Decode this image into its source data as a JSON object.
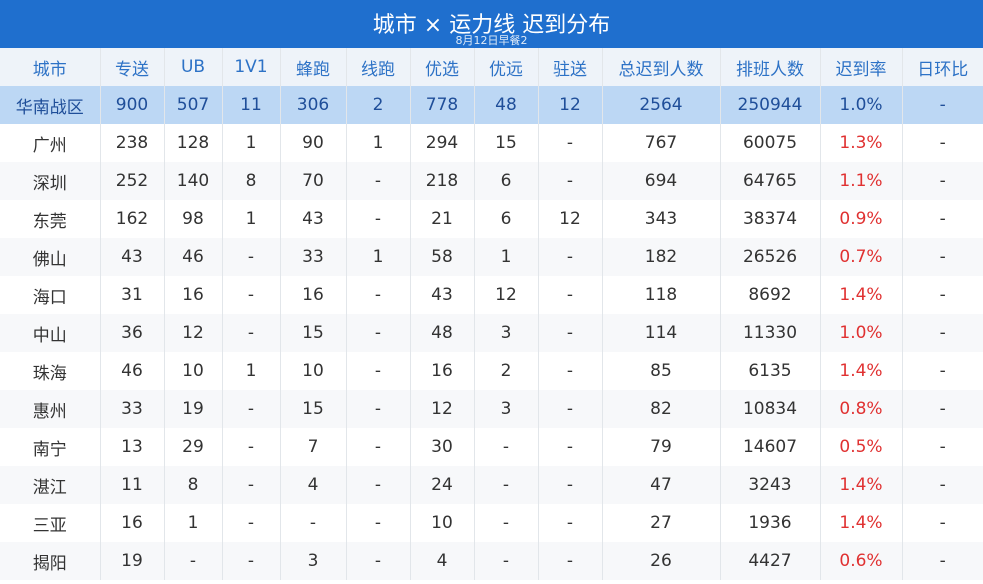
{
  "header": {
    "title": "城市 × 运力线 迟到分布",
    "subtitle": "8月12日早餐2"
  },
  "columns": [
    "城市",
    "专送",
    "UB",
    "1V1",
    "蜂跑",
    "线跑",
    "优选",
    "优远",
    "驻送",
    "总迟到人数",
    "排班人数",
    "迟到率",
    "日环比"
  ],
  "summary": [
    "华南战区",
    "900",
    "507",
    "11",
    "306",
    "2",
    "778",
    "48",
    "12",
    "2564",
    "250944",
    "1.0%",
    "-"
  ],
  "rows": [
    [
      "广州",
      "238",
      "128",
      "1",
      "90",
      "1",
      "294",
      "15",
      "-",
      "767",
      "60075",
      "1.3%",
      "-"
    ],
    [
      "深圳",
      "252",
      "140",
      "8",
      "70",
      "-",
      "218",
      "6",
      "-",
      "694",
      "64765",
      "1.1%",
      "-"
    ],
    [
      "东莞",
      "162",
      "98",
      "1",
      "43",
      "-",
      "21",
      "6",
      "12",
      "343",
      "38374",
      "0.9%",
      "-"
    ],
    [
      "佛山",
      "43",
      "46",
      "-",
      "33",
      "1",
      "58",
      "1",
      "-",
      "182",
      "26526",
      "0.7%",
      "-"
    ],
    [
      "海口",
      "31",
      "16",
      "-",
      "16",
      "-",
      "43",
      "12",
      "-",
      "118",
      "8692",
      "1.4%",
      "-"
    ],
    [
      "中山",
      "36",
      "12",
      "-",
      "15",
      "-",
      "48",
      "3",
      "-",
      "114",
      "11330",
      "1.0%",
      "-"
    ],
    [
      "珠海",
      "46",
      "10",
      "1",
      "10",
      "-",
      "16",
      "2",
      "-",
      "85",
      "6135",
      "1.4%",
      "-"
    ],
    [
      "惠州",
      "33",
      "19",
      "-",
      "15",
      "-",
      "12",
      "3",
      "-",
      "82",
      "10834",
      "0.8%",
      "-"
    ],
    [
      "南宁",
      "13",
      "29",
      "-",
      "7",
      "-",
      "30",
      "-",
      "-",
      "79",
      "14607",
      "0.5%",
      "-"
    ],
    [
      "湛江",
      "11",
      "8",
      "-",
      "4",
      "-",
      "24",
      "-",
      "-",
      "47",
      "3243",
      "1.4%",
      "-"
    ],
    [
      "三亚",
      "16",
      "1",
      "-",
      "-",
      "-",
      "10",
      "-",
      "-",
      "27",
      "1936",
      "1.4%",
      "-"
    ],
    [
      "揭阳",
      "19",
      "-",
      "-",
      "3",
      "-",
      "4",
      "-",
      "-",
      "26",
      "4427",
      "0.6%",
      "-"
    ]
  ],
  "colors": {
    "header_bg": "#1f6fce",
    "column_header_text": "#2d72c6",
    "summary_bg": "#bcd7f4",
    "rate_text": "#e03131"
  }
}
